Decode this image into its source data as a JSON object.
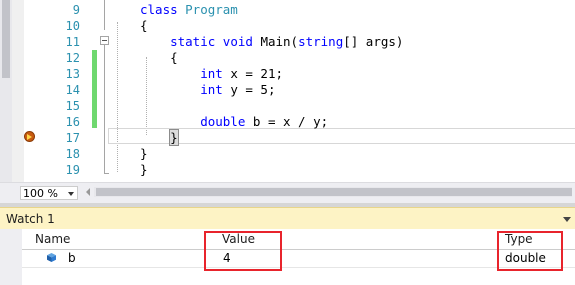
{
  "editor": {
    "lines": [
      {
        "num": "9",
        "tokens": [
          {
            "t": "class ",
            "c": "kw"
          },
          {
            "t": "Program",
            "c": "ty"
          }
        ]
      },
      {
        "num": "10",
        "tokens": [
          {
            "t": "{",
            "c": "tx"
          }
        ]
      },
      {
        "num": "11",
        "tokens": [
          {
            "t": "    static ",
            "c": "kw"
          },
          {
            "t": "void ",
            "c": "kw"
          },
          {
            "t": "Main(",
            "c": "tx"
          },
          {
            "t": "string",
            "c": "kw"
          },
          {
            "t": "[] args)",
            "c": "tx"
          }
        ]
      },
      {
        "num": "12",
        "tokens": [
          {
            "t": "    {",
            "c": "tx"
          }
        ]
      },
      {
        "num": "13",
        "tokens": [
          {
            "t": "        int ",
            "c": "kw"
          },
          {
            "t": "x = 21;",
            "c": "tx"
          }
        ]
      },
      {
        "num": "14",
        "tokens": [
          {
            "t": "        int ",
            "c": "kw"
          },
          {
            "t": "y = 5;",
            "c": "tx"
          }
        ]
      },
      {
        "num": "15",
        "tokens": []
      },
      {
        "num": "16",
        "tokens": [
          {
            "t": "        double ",
            "c": "kw"
          },
          {
            "t": "b = x / y;",
            "c": "tx"
          }
        ]
      },
      {
        "num": "17",
        "tokens": [
          {
            "t": "    ",
            "c": "tx"
          },
          {
            "t": "}",
            "c": "cursor"
          }
        ]
      },
      {
        "num": "18",
        "tokens": [
          {
            "t": "}",
            "c": "tx"
          }
        ]
      },
      {
        "num": "19",
        "tokens": [
          {
            "t": "}",
            "c": "tx"
          }
        ]
      }
    ]
  },
  "zoom": {
    "value": "100 %"
  },
  "watch": {
    "title": "Watch 1",
    "columns": {
      "name": "Name",
      "value": "Value",
      "type": "Type"
    },
    "rows": [
      {
        "name": "b",
        "value": "4",
        "type": "double"
      }
    ]
  },
  "colors": {
    "keyword": "#0000ff",
    "type_name": "#2b91af",
    "line_number": "#2b91af",
    "change_bar": "#6fd86f",
    "watch_header": "#fdf3c5",
    "highlight_box": "#e8242c",
    "exec_arrow": "#c85a10"
  },
  "icons": {
    "execution_pointer": "current-statement-arrow-icon",
    "watch_variable": "variable-cube-icon",
    "dropdown": "chevron-down-icon"
  }
}
